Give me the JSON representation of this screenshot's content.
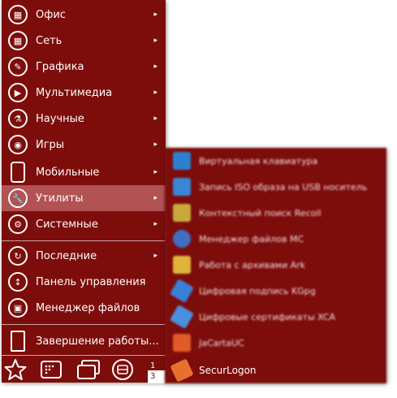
{
  "menu": {
    "items": [
      {
        "label": "Офис",
        "icon": "office-icon"
      },
      {
        "label": "Сеть",
        "icon": "network-icon"
      },
      {
        "label": "Графика",
        "icon": "graphics-icon"
      },
      {
        "label": "Мультимедиа",
        "icon": "multimedia-icon"
      },
      {
        "label": "Научные",
        "icon": "science-icon"
      },
      {
        "label": "Игры",
        "icon": "games-icon"
      },
      {
        "label": "Мобильные",
        "icon": "mobile-icon"
      },
      {
        "label": "Утилиты",
        "icon": "utilities-icon"
      },
      {
        "label": "Системные",
        "icon": "system-icon"
      },
      {
        "label": "Последние",
        "icon": "recent-icon"
      },
      {
        "label": "Панель управления",
        "icon": "control-panel-icon"
      },
      {
        "label": "Менеджер файлов",
        "icon": "file-manager-icon"
      },
      {
        "label": "Завершение работы...",
        "icon": "shutdown-icon"
      }
    ],
    "selected": "Утилиты",
    "arrow": "▸"
  },
  "submenu": {
    "items": [
      {
        "label": "Виртуальная клавиатура",
        "color": "#2f7fd0"
      },
      {
        "label": "Запись ISO образа на USB носитель",
        "color": "#3a86d6"
      },
      {
        "label": "Контекстный поиск Recoll",
        "color": "#c9a83a"
      },
      {
        "label": "Менеджер файлов МС",
        "color": "#3f6fc4"
      },
      {
        "label": "Работа с архивами Ark",
        "color": "#e0b43a"
      },
      {
        "label": "Цифровая подпись KGpg",
        "color": "#3a7fd8"
      },
      {
        "label": "Цифровые сертификаты XCA",
        "color": "#4a90e0"
      },
      {
        "label": "JaCartaUC",
        "color": "#e05a2a"
      },
      {
        "label": "SecurLogon",
        "color": "#e8702a"
      }
    ]
  },
  "taskbar": {
    "workspaces": [
      "1",
      "3"
    ],
    "buttons": [
      "favorites-star-icon",
      "apps-grid-icon",
      "windows-icon",
      "storage-icon"
    ]
  },
  "colors": {
    "menu_bg": "#7d0d0b",
    "selected_bg": "#b25252"
  }
}
